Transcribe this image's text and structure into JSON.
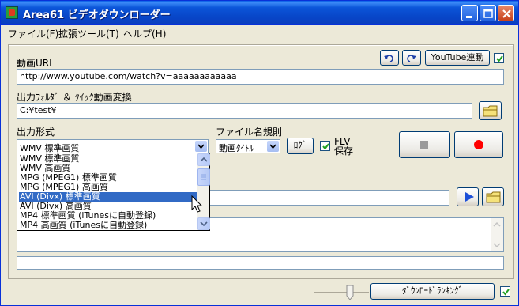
{
  "window": {
    "title": "Area61 ビデオダウンローダー",
    "controls": [
      "minimize",
      "maximize",
      "close"
    ]
  },
  "menu": [
    {
      "label": "ファイル(F)"
    },
    {
      "label": "拡張ツール(T)"
    },
    {
      "label": "ヘルプ(H)"
    }
  ],
  "url_section": {
    "label": "動画URL",
    "value": "http://www.youtube.com/watch?v=aaaaaaaaaaaa",
    "undo_icon": "undo-icon",
    "redo_icon": "redo-icon",
    "youtube_link_label": "YouTube連動",
    "youtube_link_checked": true
  },
  "output_folder": {
    "label": "出力ﾌｫﾙﾀﾞ ＆ ｸｲｯｸ動画変換",
    "value": "C:¥test¥"
  },
  "output_format": {
    "label": "出力形式",
    "selected": "WMV 標準画質",
    "options": [
      "WMV 標準画質",
      "WMV 高画質",
      "MPG (MPEG1) 標準画質",
      "MPG (MPEG1) 高画質",
      "AVI (Divx) 標準画質",
      "AVI (Divx) 高画質",
      "MP4 標準画質 (iTunesに自動登録)",
      "MP4 高画質 (iTunesに自動登録)"
    ],
    "highlighted_index": 4
  },
  "filename_rule": {
    "label": "ファイル名規則",
    "selected": "動画ﾀｲﾄﾙ",
    "log_button": "ﾛｸﾞ",
    "flv_save_label": "FLV\n保存",
    "flv_save_checked": true
  },
  "controls": {
    "stop_icon": "stop-icon",
    "record_icon": "record-icon",
    "play_icon": "play-icon",
    "folder_icon": "folder-icon"
  },
  "footer": {
    "ranking_button": "ﾀﾞｳﾝﾛｰﾄﾞﾗﾝｷﾝｸﾞ",
    "ranking_checked": true
  },
  "colors": {
    "titlebar": "#0a4fd8",
    "selection": "#316ac5",
    "record": "#ff0000",
    "play": "#1c4fd8"
  }
}
